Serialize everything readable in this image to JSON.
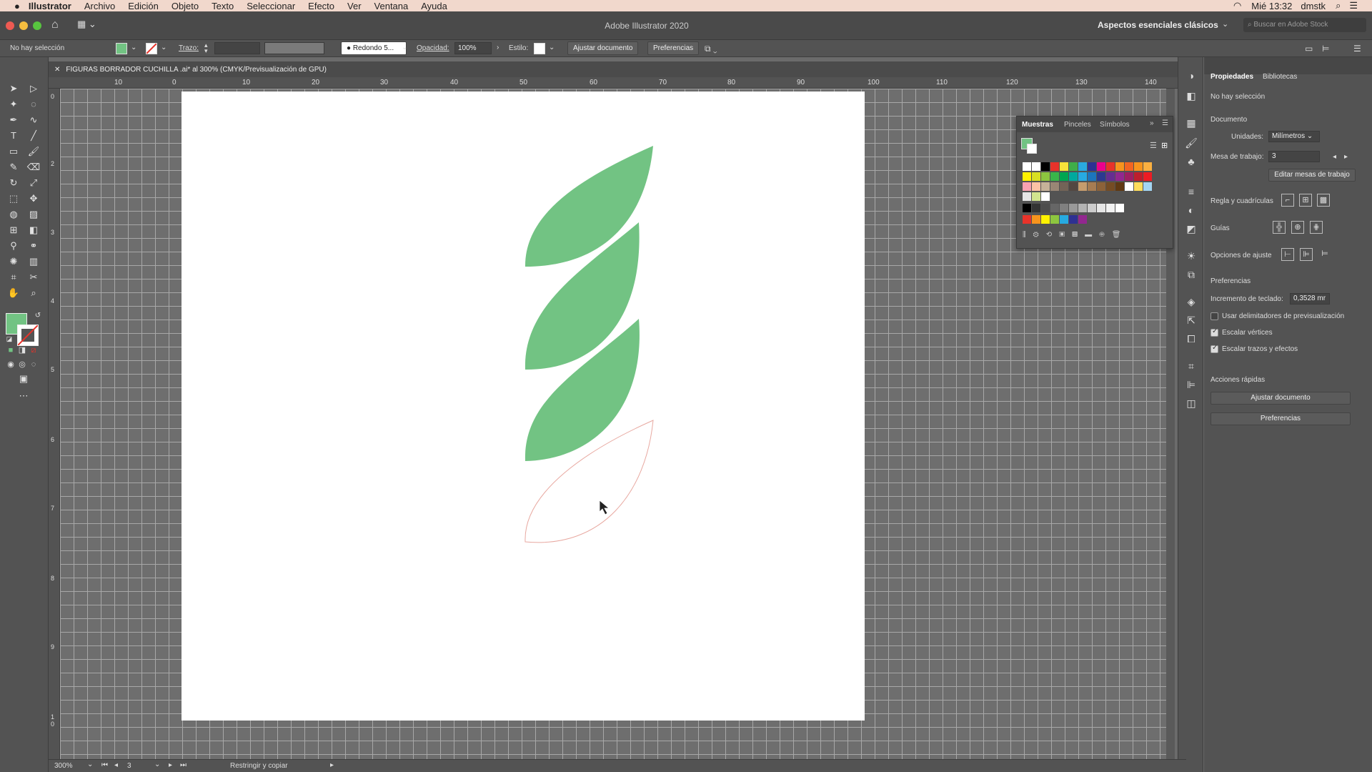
{
  "menubar": {
    "apple": "",
    "app_name": "Illustrator",
    "items": [
      "Archivo",
      "Edición",
      "Objeto",
      "Texto",
      "Seleccionar",
      "Efecto",
      "Ver",
      "Ventana",
      "Ayuda"
    ],
    "clock": "Mié 13:32",
    "user": "dmstk"
  },
  "titlebar": {
    "title": "Adobe Illustrator 2020",
    "workspace": "Aspectos esenciales clásicos",
    "search_placeholder": "Buscar en Adobe Stock"
  },
  "controlbar": {
    "selection": "No hay selección",
    "stroke_label": "Trazo:",
    "brush": "Redondo 5...",
    "opacity_label": "Opacidad:",
    "opacity_value": "100%",
    "style_label": "Estilo:",
    "fit_doc": "Ajustar documento",
    "prefs": "Preferencias"
  },
  "document": {
    "tab_title": "FIGURAS BORRADOR CUCHILLA .ai* al 300% (CMYK/Previsualización de GPU)",
    "h_ruler": [
      "10",
      "0",
      "10",
      "20",
      "30",
      "40",
      "50",
      "60",
      "70",
      "80",
      "90",
      "100",
      "110",
      "120",
      "130",
      "140"
    ],
    "v_ruler": [
      "0",
      "2",
      "3",
      "4",
      "5",
      "6",
      "7",
      "8",
      "9",
      "1 0"
    ],
    "leaf_color": "#72c383",
    "outline_color": "#e8a8a0"
  },
  "status": {
    "zoom": "300%",
    "artboard": "3",
    "mode": "Restringir y copiar"
  },
  "swatches": {
    "tabs": [
      "Muestras",
      "Pinceles",
      "Símbolos"
    ],
    "fill_color": "#72c383",
    "rows": [
      [
        "#ffffff",
        "#ffffff",
        "#000000",
        "#e8332a",
        "#f7e23a",
        "#3fae49",
        "#2aa9e0",
        "#2e3192",
        "#ec008c",
        "#e8332a",
        "#f7941d",
        "#f26522",
        "#f7941d",
        "#fbb040"
      ],
      [
        "#fff200",
        "#d7df23",
        "#8dc63f",
        "#39b54a",
        "#00a651",
        "#00a99d",
        "#27aae1",
        "#1c75bc",
        "#2b3990",
        "#662d91",
        "#92278f",
        "#9e1f63",
        "#be1e2d",
        "#ed1c24"
      ],
      [
        "#f9a1b1",
        "#fcc2a5",
        "#c7b299",
        "#998675",
        "#736357",
        "#534741",
        "#c69c6d",
        "#a67c52",
        "#8c6239",
        "#754c24",
        "#603913",
        "#ffffff",
        "#fddc5c",
        "#a3d5f2"
      ],
      [
        "#e6e6e6",
        "#d1e38e",
        "#ffffff"
      ],
      [
        "#000000",
        "#333333",
        "#4d4d4d",
        "#666666",
        "#808080",
        "#999999",
        "#b3b3b3",
        "#cccccc",
        "#e6e6e6",
        "#f2f2f2",
        "#ffffff"
      ],
      [
        "#e8332a",
        "#f7941d",
        "#fff200",
        "#8dc63f",
        "#27aae1",
        "#2e3192",
        "#92278f"
      ]
    ]
  },
  "properties": {
    "tabs": [
      "Propiedades",
      "Bibliotecas"
    ],
    "no_selection": "No hay selección",
    "document_label": "Documento",
    "units_label": "Unidades:",
    "units_value": "Milímetros",
    "artboard_label": "Mesa de trabajo:",
    "artboard_value": "3",
    "edit_artboards": "Editar mesas de trabajo",
    "rulers_grids": "Regla y cuadrículas",
    "guides": "Guías",
    "snap_options": "Opciones de ajuste",
    "preferences_label": "Preferencias",
    "key_increment_label": "Incremento de teclado:",
    "key_increment_value": "0,3528 mr",
    "chk1": "Usar delimitadores de previsualización",
    "chk2": "Escalar vértices",
    "chk3": "Escalar trazos y efectos",
    "quick_actions": "Acciones rápidas",
    "fit_doc_btn": "Ajustar documento",
    "prefs_btn": "Preferencias"
  }
}
